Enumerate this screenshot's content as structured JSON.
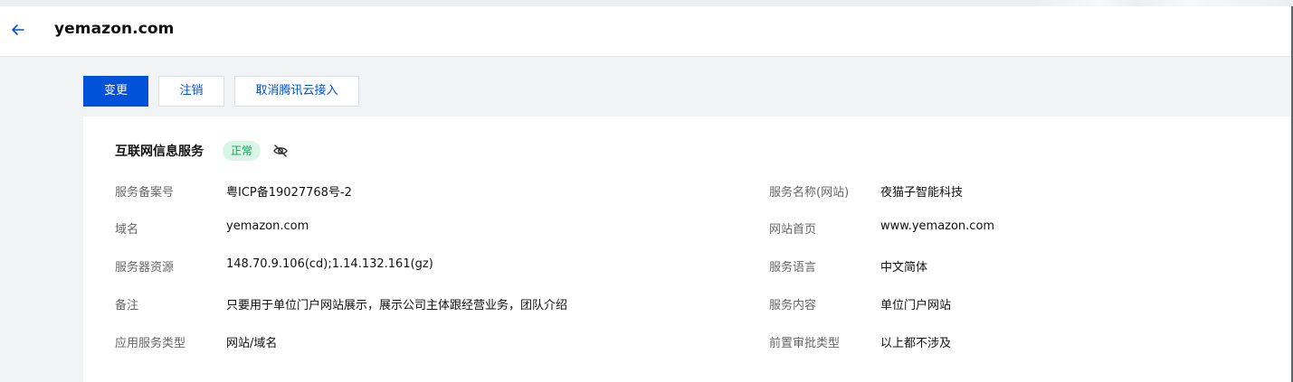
{
  "header": {
    "title": "yemazon.com",
    "back_icon": "arrow-left-icon"
  },
  "toolbar": {
    "change_label": "变更",
    "cancel_label": "注销",
    "cancel_access_label": "取消腾讯云接入"
  },
  "section": {
    "title": "互联网信息服务",
    "status": "正常",
    "visibility_icon": "eye-off-icon"
  },
  "details": {
    "left": [
      {
        "label": "服务备案号",
        "value": "粤ICP备19027768号-2"
      },
      {
        "label": "域名",
        "value": "yemazon.com"
      },
      {
        "label": "服务器资源",
        "value": "148.70.9.106(cd);1.14.132.161(gz)"
      },
      {
        "label": "备注",
        "value": "只要用于单位门户网站展示，展示公司主体跟经营业务，团队介绍"
      },
      {
        "label": "应用服务类型",
        "value": "网站/域名"
      }
    ],
    "right": [
      {
        "label": "服务名称(网站)",
        "value": "夜猫子智能科技"
      },
      {
        "label": "网站首页",
        "value": "www.yemazon.com"
      },
      {
        "label": "服务语言",
        "value": "中文简体"
      },
      {
        "label": "服务内容",
        "value": "单位门户网站"
      },
      {
        "label": "前置审批类型",
        "value": "以上都不涉及"
      }
    ]
  },
  "colors": {
    "primary": "#0052d9",
    "status_bg": "#d9f5e6",
    "status_text": "#12a05a"
  }
}
